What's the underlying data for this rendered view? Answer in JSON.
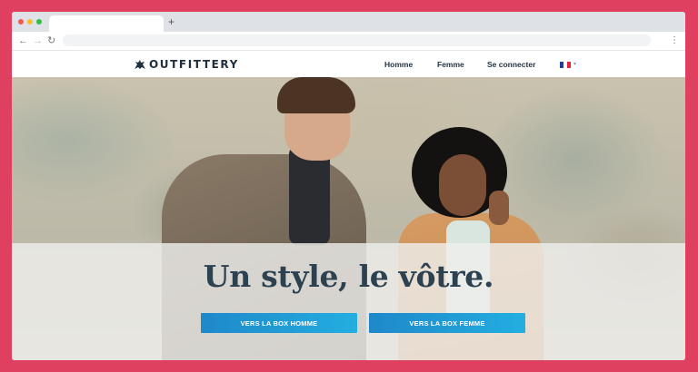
{
  "browser": {
    "new_tab_label": "+",
    "back_icon": "arrow-left-icon",
    "forward_icon": "arrow-right-icon",
    "reload_icon": "reload-icon",
    "menu_icon": "vertical-dots-icon",
    "traffic_light_colors": [
      "#f2594f",
      "#f7bd2c",
      "#2fc240"
    ]
  },
  "header": {
    "logo_text": "OUTFITTERY",
    "nav": {
      "homme": "Homme",
      "femme": "Femme",
      "login": "Se connecter"
    },
    "language_icon": "french-flag-icon"
  },
  "hero": {
    "headline": "Un style, le vôtre.",
    "cta_homme": "VERS LA BOX HOMME",
    "cta_femme": "VERS LA BOX FEMME"
  },
  "colors": {
    "frame": "#e0405f",
    "headline": "#2d4251",
    "cta_start": "#1f88c9",
    "cta_end": "#23aee0"
  }
}
